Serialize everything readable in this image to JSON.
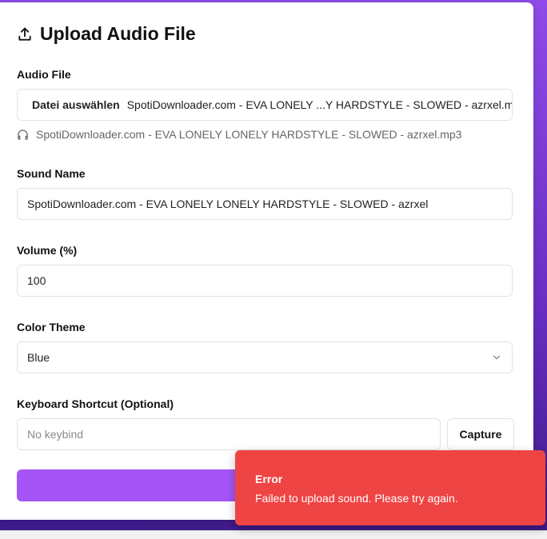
{
  "card": {
    "title": "Upload Audio File",
    "title_icon": "upload-icon"
  },
  "audio_file": {
    "label": "Audio File",
    "button_label": "Datei auswählen",
    "selected_file_display": "SpotiDownloader.com - EVA LONELY ...Y HARDSTYLE - SLOWED - azrxel.mp3",
    "file_info_icon": "headphones-icon",
    "file_info_name": "SpotiDownloader.com - EVA LONELY LONELY HARDSTYLE - SLOWED - azrxel.mp3"
  },
  "sound_name": {
    "label": "Sound Name",
    "value": "SpotiDownloader.com - EVA LONELY LONELY HARDSTYLE - SLOWED - azrxel"
  },
  "volume": {
    "label": "Volume (%)",
    "value": "100"
  },
  "color_theme": {
    "label": "Color Theme",
    "selected": "Blue"
  },
  "keyboard_shortcut": {
    "label": "Keyboard Shortcut (Optional)",
    "placeholder": "No keybind",
    "capture_label": "Capture"
  },
  "upload_button": {
    "label": "U"
  },
  "toast": {
    "title": "Error",
    "message": "Failed to upload sound. Please try again.",
    "color": "#ef4444"
  },
  "colors": {
    "accent": "#a555f5",
    "background_gradient_top": "#8e4be8",
    "background_gradient_bottom": "#3d1a8a"
  }
}
